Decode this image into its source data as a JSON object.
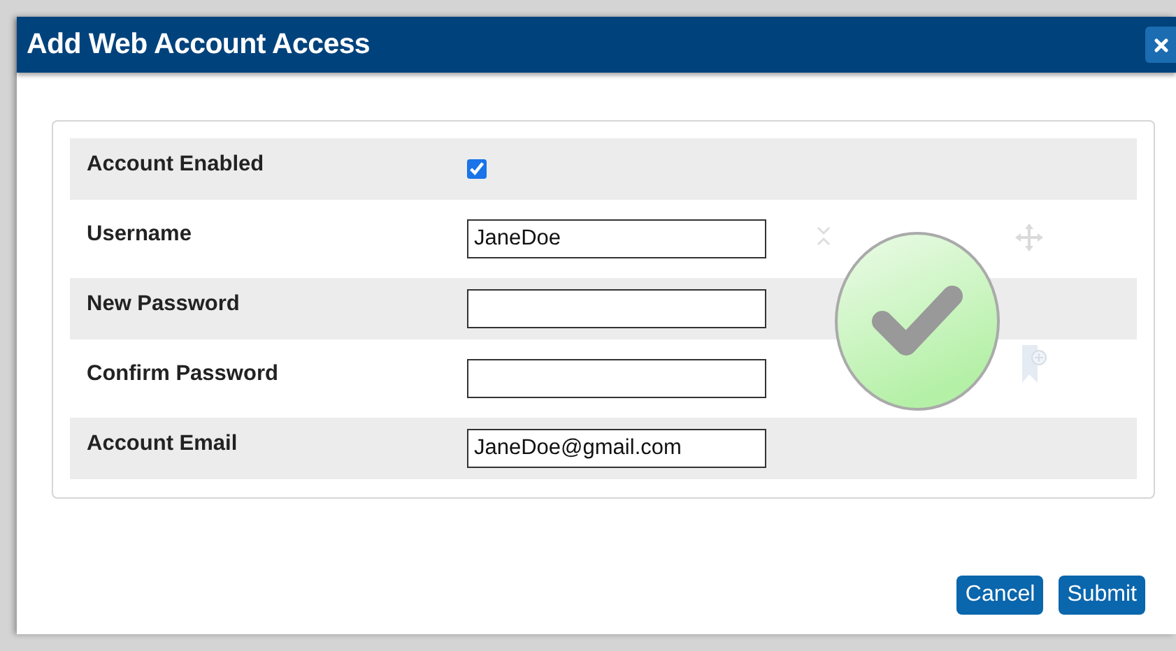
{
  "dialog": {
    "title": "Add Web Account Access"
  },
  "fields": [
    {
      "kind": "checkbox",
      "label": "Account Enabled",
      "checked": true
    },
    {
      "kind": "text",
      "label": "Username",
      "value": "JaneDoe"
    },
    {
      "kind": "text",
      "label": "New Password"
    },
    {
      "kind": "text",
      "label": "Confirm Password"
    },
    {
      "kind": "text",
      "label": "Account Email",
      "value": "JaneDoe@gmail.com"
    }
  ],
  "buttons": [
    {
      "label": "Cancel"
    },
    {
      "label": "Submit"
    }
  ]
}
